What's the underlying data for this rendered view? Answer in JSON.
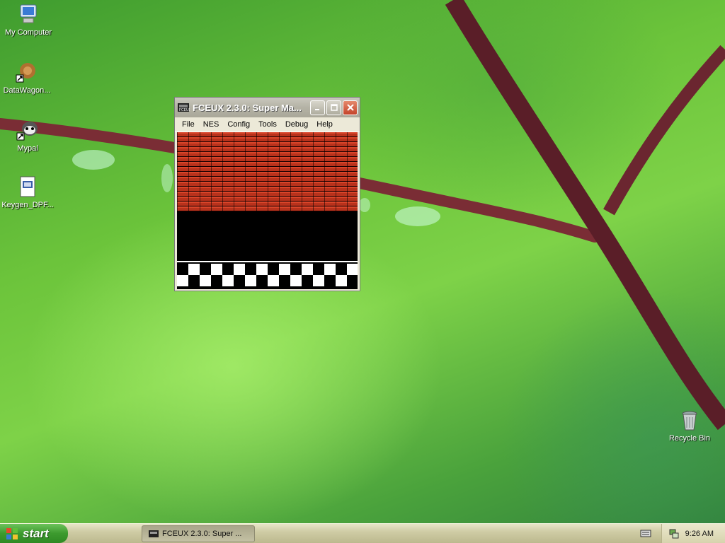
{
  "desktop": {
    "icons": [
      {
        "label": "My Computer",
        "icon": "my-computer-icon"
      },
      {
        "label": "DataWagon...",
        "icon": "datawagon-icon"
      },
      {
        "label": "Mypal",
        "icon": "mypal-icon"
      },
      {
        "label": "Keygen_DPF...",
        "icon": "keygen-file-icon"
      },
      {
        "label": "Recycle Bin",
        "icon": "recycle-bin-icon"
      }
    ]
  },
  "window": {
    "title": "FCEUX 2.3.0: Super Ma...",
    "menu": [
      "File",
      "NES",
      "Config",
      "Tools",
      "Debug",
      "Help"
    ]
  },
  "taskbar": {
    "start_label": "start",
    "tasks": [
      {
        "label": "FCEUX 2.3.0: Super ..."
      }
    ],
    "clock": "9:26 AM"
  },
  "colors": {
    "taskbar": "#d7d3ad",
    "start": "#3c9a2e",
    "brick": "#c43a20"
  }
}
